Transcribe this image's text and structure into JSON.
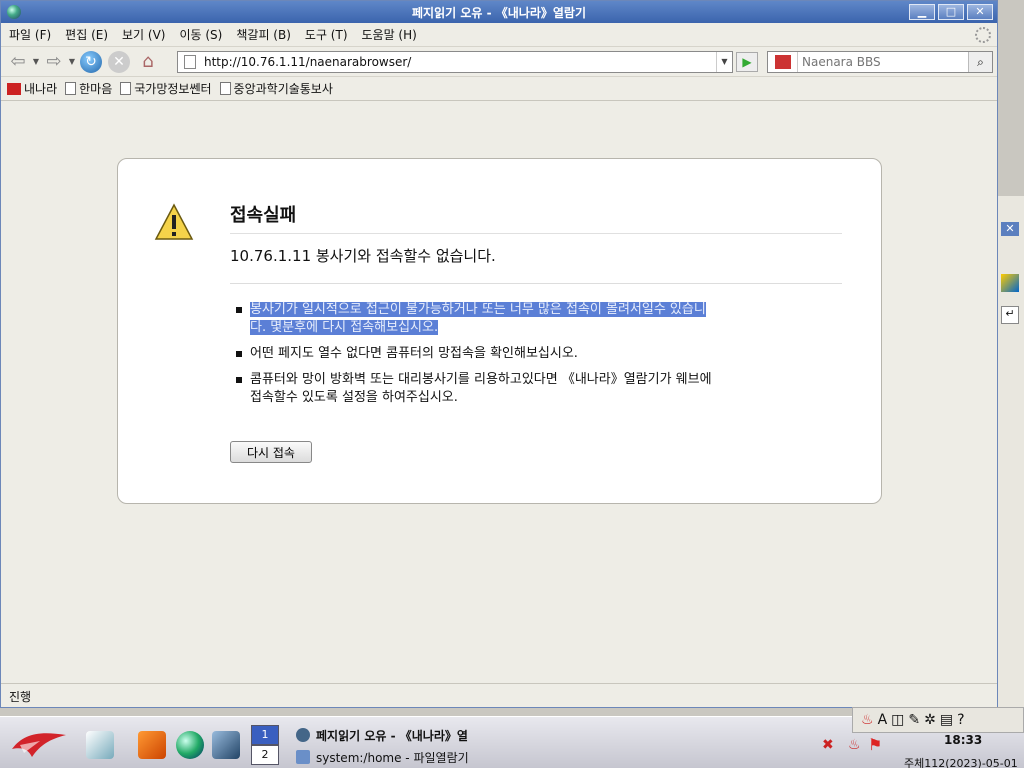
{
  "window": {
    "title": "페지읽기 오유 - 《내나라》열람기",
    "buttons": {
      "minimize": "▁",
      "maximize": "□",
      "close": "✕"
    }
  },
  "menu": [
    "파일 (F)",
    "편집 (E)",
    "보기 (V)",
    "이동 (S)",
    "책갈피 (B)",
    "도구 (T)",
    "도움말 (H)"
  ],
  "nav": {
    "url": "http://10.76.1.11/naenarabrowser/",
    "search_placeholder": "Naenara BBS"
  },
  "bookmarks": [
    "내나라",
    "한마음",
    "국가망정보쎈터",
    "중앙과학기술통보사"
  ],
  "error": {
    "title": "접속실패",
    "message": "10.76.1.11 봉사기와 접속할수 없습니다.",
    "items": [
      [
        "봉사기가 일시적으로 접근이 불가능하거나 또는 너무 많은 접속이 몰려서일수 있습니",
        "다. 몇분후에 다시 접속해보십시오."
      ],
      [
        "어떤 페지도 열수 없다면 콤퓨터의 망접속을 확인해보십시오."
      ],
      [
        "콤퓨터와 망이 방화벽 또는 대리봉사기를 리용하고있다면 《내나라》열람기가 웨브에",
        "접속할수 있도록 설정을 하여주십시오."
      ]
    ],
    "try_again": "다시 접속"
  },
  "status": "진행",
  "taskbar": {
    "pages": [
      "1",
      "2"
    ],
    "tasks": [
      "페지읽기 오유 - 《내나라》열",
      "system:/home - 파일열람기"
    ],
    "clock": "18:33",
    "date": "주체112(2023)-05-01"
  },
  "colors": {
    "title_bar": "#3b64ad",
    "selection": "#5b7fd6"
  }
}
